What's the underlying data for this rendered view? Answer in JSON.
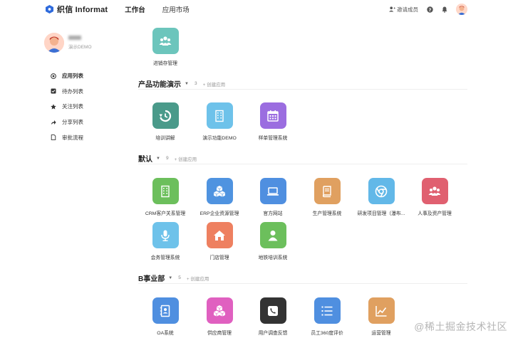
{
  "topbar": {
    "logo_text": "织信 Informat",
    "tabs": [
      {
        "label": "工作台",
        "active": true
      },
      {
        "label": "应用市场",
        "active": false
      }
    ],
    "invite_label": "邀请成员",
    "help_icon": "question-icon",
    "bell_icon": "bell-icon",
    "accent": "#2f6bdc"
  },
  "sidebar": {
    "profile_role": "演示DEMO",
    "items": [
      {
        "label": "应用列表",
        "icon": "target-icon",
        "active": true
      },
      {
        "label": "待办列表",
        "icon": "check-square-icon",
        "active": false
      },
      {
        "label": "关注列表",
        "icon": "star-icon",
        "active": false
      },
      {
        "label": "分享列表",
        "icon": "share-icon",
        "active": false
      },
      {
        "label": "审批流程",
        "icon": "document-icon",
        "active": false
      }
    ]
  },
  "groups": [
    {
      "title": "",
      "apps": [
        {
          "label": "进销存管理",
          "color": "#6cc5bc",
          "icon": "users-icon"
        }
      ]
    },
    {
      "title": "产品功能演示",
      "count": "3",
      "add_label": "+ 创建应用",
      "apps": [
        {
          "label": "培训讲解",
          "color": "#4a9a8a",
          "icon": "history-icon"
        },
        {
          "label": "演示功能DEMO",
          "color": "#6ec2ea",
          "icon": "building-icon"
        },
        {
          "label": "样单管理系统",
          "color": "#9b6de0",
          "icon": "calendar-icon"
        }
      ]
    },
    {
      "title": "默认",
      "count": "9",
      "add_label": "+ 创建应用",
      "apps": [
        {
          "label": "CRM客户关系管理",
          "color": "#6cbf5c",
          "icon": "building-icon"
        },
        {
          "label": "ERP企业资源管理",
          "color": "#4f93e0",
          "icon": "cubes-icon"
        },
        {
          "label": "官方网站",
          "color": "#4f8fe0",
          "icon": "laptop-icon"
        },
        {
          "label": "生产管理系统",
          "color": "#e0a060",
          "icon": "book-icon"
        },
        {
          "label": "研发项目管理（瀑布...",
          "color": "#62b8e8",
          "icon": "chrome-icon"
        },
        {
          "label": "人事及资产管理",
          "color": "#e06070",
          "icon": "users-icon"
        },
        {
          "label": "会务管理系统",
          "color": "#6ec2ea",
          "icon": "mic-icon"
        },
        {
          "label": "门店管理",
          "color": "#ee8060",
          "icon": "home-icon"
        },
        {
          "label": "地铁培训系统",
          "color": "#6cbf5c",
          "icon": "user-icon"
        }
      ]
    },
    {
      "title": "B事业部",
      "count": "5",
      "add_label": "+ 创建应用",
      "apps": [
        {
          "label": "OA系统",
          "color": "#4f8fe0",
          "icon": "contact-book-icon"
        },
        {
          "label": "供应商管理",
          "color": "#e060c0",
          "icon": "cubes-icon"
        },
        {
          "label": "用户调查反馈",
          "color": "#333333",
          "icon": "phone-icon"
        },
        {
          "label": "员工360度评价",
          "color": "#4f8fe0",
          "icon": "list-numbered-icon"
        },
        {
          "label": "运营管理",
          "color": "#e0a060",
          "icon": "line-chart-icon"
        }
      ]
    }
  ],
  "watermark": "@稀土掘金技术社区"
}
